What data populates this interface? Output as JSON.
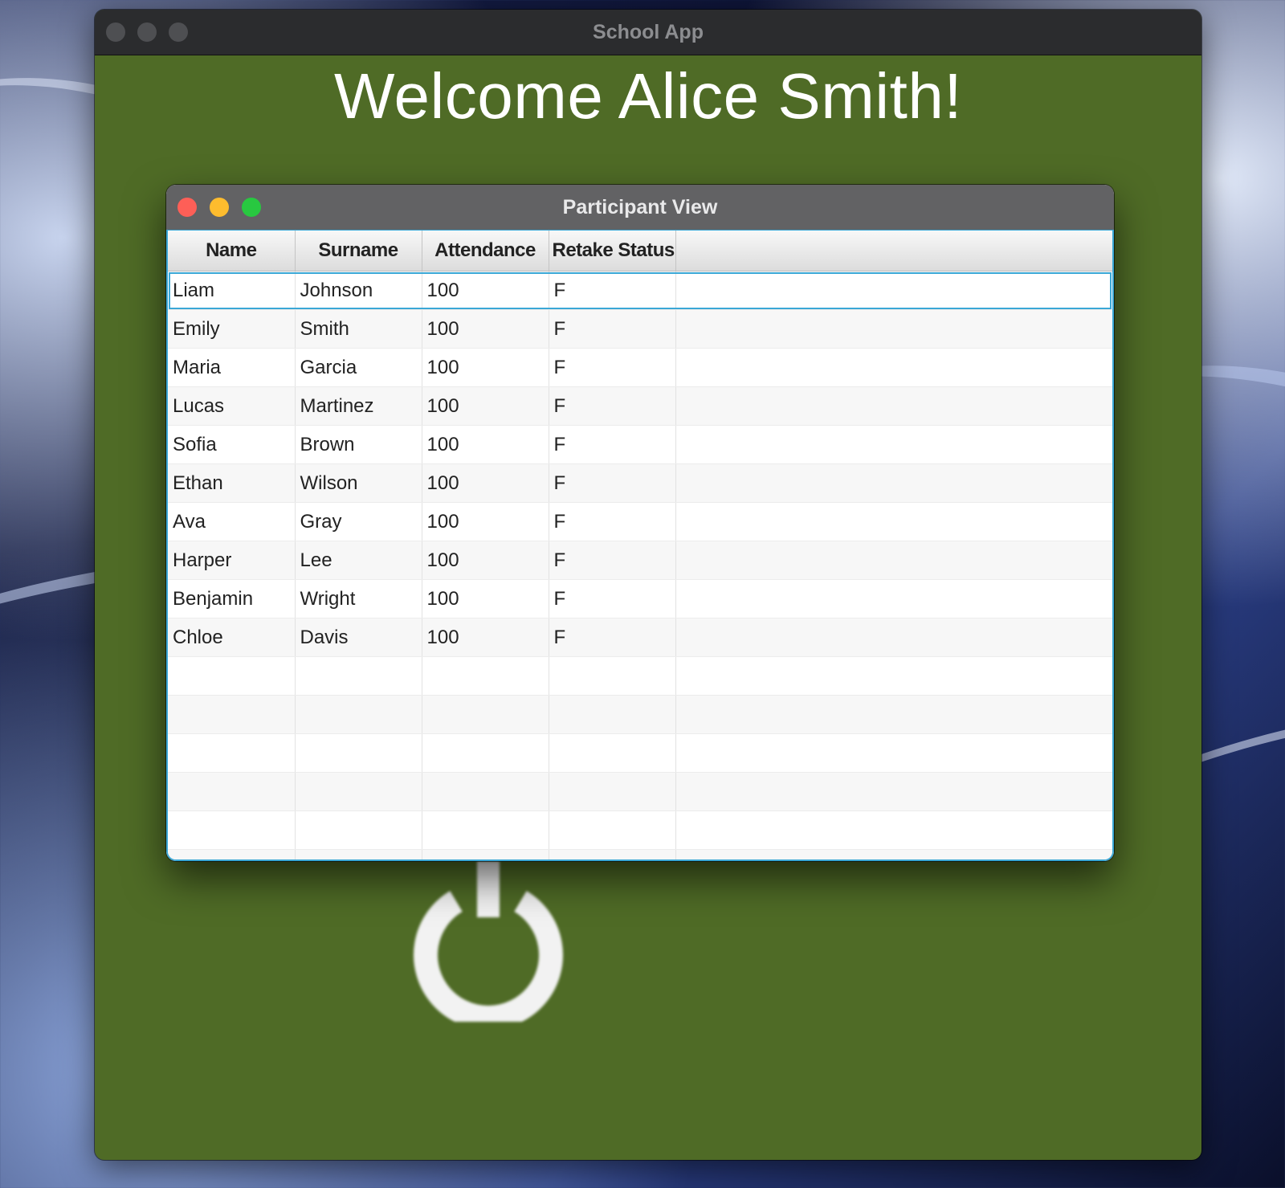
{
  "main_window": {
    "title": "School App",
    "welcome_text": "Welcome Alice Smith!"
  },
  "participant_window": {
    "title": "Participant View",
    "columns": [
      "Name",
      "Surname",
      "Attendance",
      "Retake Status"
    ],
    "rows": [
      {
        "name": "Liam",
        "surname": "Johnson",
        "attendance": "100",
        "retake": "F"
      },
      {
        "name": "Emily",
        "surname": "Smith",
        "attendance": "100",
        "retake": "F"
      },
      {
        "name": "Maria",
        "surname": "Garcia",
        "attendance": "100",
        "retake": "F"
      },
      {
        "name": "Lucas",
        "surname": "Martinez",
        "attendance": "100",
        "retake": "F"
      },
      {
        "name": "Sofia",
        "surname": "Brown",
        "attendance": "100",
        "retake": "F"
      },
      {
        "name": "Ethan",
        "surname": "Wilson",
        "attendance": "100",
        "retake": "F"
      },
      {
        "name": "Ava",
        "surname": "Gray",
        "attendance": "100",
        "retake": "F"
      },
      {
        "name": "Harper",
        "surname": "Lee",
        "attendance": "100",
        "retake": "F"
      },
      {
        "name": "Benjamin",
        "surname": "Wright",
        "attendance": "100",
        "retake": "F"
      },
      {
        "name": "Chloe",
        "surname": "Davis",
        "attendance": "100",
        "retake": "F"
      }
    ],
    "selected_row": 0
  },
  "icons": {
    "logout": "power-icon"
  },
  "colors": {
    "main_background": "#4f6b26",
    "selection_border": "#3aa7d6",
    "close": "#fe5f57",
    "minimize": "#febc2e",
    "zoom": "#28c840"
  }
}
